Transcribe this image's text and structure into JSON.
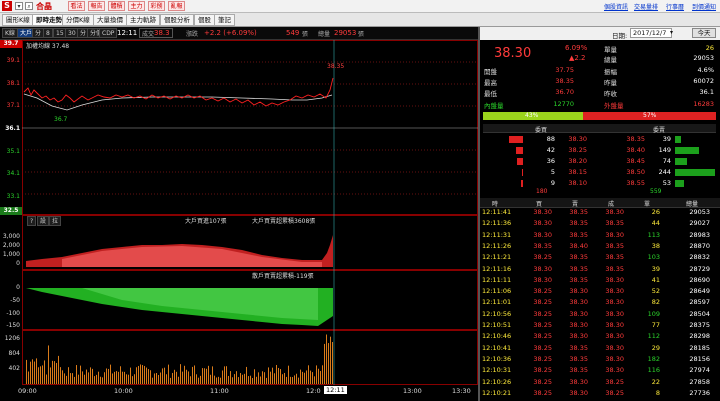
{
  "toolbar": {
    "symbol": "合晶",
    "quick_buttons": [
      "看法",
      "報告",
      "體積",
      "主力",
      "彩捌",
      "亂報"
    ],
    "links": [
      "個股資訊",
      "交易量排",
      "行事曆",
      "到價通知"
    ]
  },
  "tabs": [
    "圖形K線",
    "即時走勢",
    "分價K線",
    "大量換價",
    "主力軌跡",
    "個股分析",
    "個股",
    "筆記"
  ],
  "active_tab": 1,
  "chart_toolbar": {
    "buttons": [
      "K線",
      "大戶",
      "分",
      "8",
      "15",
      "30",
      "分",
      "分價",
      "CDP"
    ],
    "time": "12:11",
    "price_label": "成交",
    "price": "38.3",
    "change_label": "漲跌",
    "change": "+2.2 (+6.09%)",
    "vol_label": "",
    "vol": "549",
    "vol_unit": "張",
    "total_label": "總量",
    "total": "29053",
    "total_unit": "張"
  },
  "price_chart": {
    "legend": "加權均線 37.48",
    "yticks": [
      "39.7",
      "39.1",
      "38.1",
      "37.1",
      "36.1",
      "35.1",
      "34.1",
      "33.1",
      "32.5"
    ],
    "high_label": "38.35",
    "low_label": "36.7"
  },
  "big_chart": {
    "buttons": [
      "?",
      "設",
      "拉"
    ],
    "label1": "大戶買進107張",
    "label2": "大戶買賣超累積3608張",
    "yticks": [
      "3,000",
      "2,000",
      "1,000",
      "0"
    ]
  },
  "retail_chart": {
    "label": "散戶買賣超累積-119張",
    "yticks": [
      "0",
      "-50",
      "-100",
      "-150"
    ]
  },
  "vol_chart": {
    "yticks": [
      "1206",
      "804",
      "402"
    ]
  },
  "xaxis": [
    "09:00",
    "10:00",
    "11:00",
    "12:0",
    "12:11",
    "13:00",
    "13:30"
  ],
  "date_panel": {
    "date_label": "日期:",
    "date": "2017/12/7",
    "today": "今天"
  },
  "quote": {
    "price": "38.30",
    "pct": "6.09%",
    "change": "▲2.2",
    "vol_label": "單量",
    "vol": "26",
    "total_label": "總量",
    "total": "29053",
    "rows": [
      {
        "l1": "開盤",
        "v1": "37.75",
        "l2": "振幅",
        "v2": "4.6%"
      },
      {
        "l1": "最高",
        "v1": "38.35",
        "l2": "昨量",
        "v2": "60072"
      },
      {
        "l1": "最低",
        "v1": "36.70",
        "l2": "昨收",
        "v2": "36.1"
      }
    ],
    "inner_label": "內盤量",
    "inner": "12770",
    "outer_label": "外盤量",
    "outer": "16283",
    "inner_pct": "43%",
    "outer_pct": "57%"
  },
  "order_book": {
    "bid_header": "委買",
    "ask_header": "委賣",
    "rows": [
      {
        "bq": "88",
        "bp": "38.30",
        "ap": "38.35",
        "aq": "39"
      },
      {
        "bq": "42",
        "bp": "38.25",
        "ap": "38.40",
        "aq": "149"
      },
      {
        "bq": "36",
        "bp": "38.20",
        "ap": "38.45",
        "aq": "74"
      },
      {
        "bq": "5",
        "bp": "38.15",
        "ap": "38.50",
        "aq": "244"
      },
      {
        "bq": "9",
        "bp": "38.10",
        "ap": "38.55",
        "aq": "53"
      }
    ],
    "bid_total": "180",
    "ask_total": "559",
    "bid_fill": [
      0.35,
      0.17,
      0.15,
      0.03,
      0.04
    ],
    "ask_fill": [
      0.16,
      0.61,
      0.3,
      1.0,
      0.22
    ]
  },
  "ticks_header": [
    "時",
    "買",
    "賣",
    "成",
    "單",
    "總量"
  ],
  "ticks": [
    [
      "12:11:41",
      "38.30",
      "38.35",
      "38.30",
      "26",
      "29053"
    ],
    [
      "12:11:36",
      "38.30",
      "38.35",
      "38.35",
      "44",
      "29027"
    ],
    [
      "12:11:31",
      "38.30",
      "38.35",
      "38.30",
      "113",
      "28983"
    ],
    [
      "12:11:26",
      "38.35",
      "38.40",
      "38.35",
      "38",
      "28870"
    ],
    [
      "12:11:21",
      "38.25",
      "38.35",
      "38.35",
      "103",
      "28832"
    ],
    [
      "12:11:16",
      "38.30",
      "38.35",
      "38.35",
      "39",
      "28729"
    ],
    [
      "12:11:11",
      "38.30",
      "38.35",
      "38.30",
      "41",
      "28690"
    ],
    [
      "12:11:06",
      "38.25",
      "38.30",
      "38.30",
      "52",
      "28649"
    ],
    [
      "12:11:01",
      "38.25",
      "38.30",
      "38.30",
      "82",
      "28597"
    ],
    [
      "12:10:56",
      "38.25",
      "38.30",
      "38.30",
      "109",
      "28504"
    ],
    [
      "12:10:51",
      "38.25",
      "38.30",
      "38.30",
      "77",
      "28375"
    ],
    [
      "12:10:46",
      "38.25",
      "38.30",
      "38.30",
      "112",
      "28298"
    ],
    [
      "12:10:41",
      "38.25",
      "38.35",
      "38.30",
      "29",
      "28185"
    ],
    [
      "12:10:36",
      "38.25",
      "38.35",
      "38.30",
      "182",
      "28156"
    ],
    [
      "12:10:31",
      "38.25",
      "38.35",
      "38.30",
      "116",
      "27974"
    ],
    [
      "12:10:26",
      "38.25",
      "38.30",
      "38.25",
      "22",
      "27858"
    ],
    [
      "12:10:21",
      "38.25",
      "38.30",
      "38.25",
      "8",
      "27736"
    ]
  ]
}
